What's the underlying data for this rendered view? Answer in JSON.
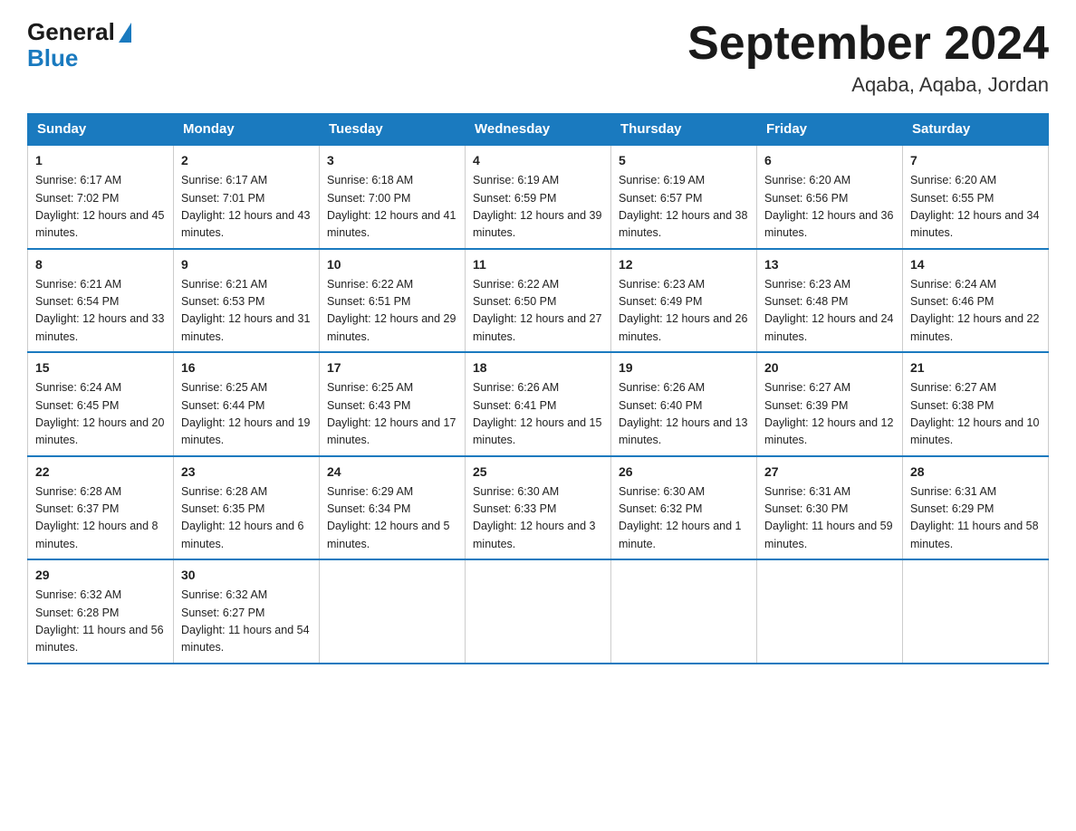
{
  "logo": {
    "general": "General",
    "blue": "Blue"
  },
  "title": "September 2024",
  "location": "Aqaba, Aqaba, Jordan",
  "days_of_week": [
    "Sunday",
    "Monday",
    "Tuesday",
    "Wednesday",
    "Thursday",
    "Friday",
    "Saturday"
  ],
  "weeks": [
    [
      {
        "day": "1",
        "sunrise": "6:17 AM",
        "sunset": "7:02 PM",
        "daylight": "12 hours and 45 minutes."
      },
      {
        "day": "2",
        "sunrise": "6:17 AM",
        "sunset": "7:01 PM",
        "daylight": "12 hours and 43 minutes."
      },
      {
        "day": "3",
        "sunrise": "6:18 AM",
        "sunset": "7:00 PM",
        "daylight": "12 hours and 41 minutes."
      },
      {
        "day": "4",
        "sunrise": "6:19 AM",
        "sunset": "6:59 PM",
        "daylight": "12 hours and 39 minutes."
      },
      {
        "day": "5",
        "sunrise": "6:19 AM",
        "sunset": "6:57 PM",
        "daylight": "12 hours and 38 minutes."
      },
      {
        "day": "6",
        "sunrise": "6:20 AM",
        "sunset": "6:56 PM",
        "daylight": "12 hours and 36 minutes."
      },
      {
        "day": "7",
        "sunrise": "6:20 AM",
        "sunset": "6:55 PM",
        "daylight": "12 hours and 34 minutes."
      }
    ],
    [
      {
        "day": "8",
        "sunrise": "6:21 AM",
        "sunset": "6:54 PM",
        "daylight": "12 hours and 33 minutes."
      },
      {
        "day": "9",
        "sunrise": "6:21 AM",
        "sunset": "6:53 PM",
        "daylight": "12 hours and 31 minutes."
      },
      {
        "day": "10",
        "sunrise": "6:22 AM",
        "sunset": "6:51 PM",
        "daylight": "12 hours and 29 minutes."
      },
      {
        "day": "11",
        "sunrise": "6:22 AM",
        "sunset": "6:50 PM",
        "daylight": "12 hours and 27 minutes."
      },
      {
        "day": "12",
        "sunrise": "6:23 AM",
        "sunset": "6:49 PM",
        "daylight": "12 hours and 26 minutes."
      },
      {
        "day": "13",
        "sunrise": "6:23 AM",
        "sunset": "6:48 PM",
        "daylight": "12 hours and 24 minutes."
      },
      {
        "day": "14",
        "sunrise": "6:24 AM",
        "sunset": "6:46 PM",
        "daylight": "12 hours and 22 minutes."
      }
    ],
    [
      {
        "day": "15",
        "sunrise": "6:24 AM",
        "sunset": "6:45 PM",
        "daylight": "12 hours and 20 minutes."
      },
      {
        "day": "16",
        "sunrise": "6:25 AM",
        "sunset": "6:44 PM",
        "daylight": "12 hours and 19 minutes."
      },
      {
        "day": "17",
        "sunrise": "6:25 AM",
        "sunset": "6:43 PM",
        "daylight": "12 hours and 17 minutes."
      },
      {
        "day": "18",
        "sunrise": "6:26 AM",
        "sunset": "6:41 PM",
        "daylight": "12 hours and 15 minutes."
      },
      {
        "day": "19",
        "sunrise": "6:26 AM",
        "sunset": "6:40 PM",
        "daylight": "12 hours and 13 minutes."
      },
      {
        "day": "20",
        "sunrise": "6:27 AM",
        "sunset": "6:39 PM",
        "daylight": "12 hours and 12 minutes."
      },
      {
        "day": "21",
        "sunrise": "6:27 AM",
        "sunset": "6:38 PM",
        "daylight": "12 hours and 10 minutes."
      }
    ],
    [
      {
        "day": "22",
        "sunrise": "6:28 AM",
        "sunset": "6:37 PM",
        "daylight": "12 hours and 8 minutes."
      },
      {
        "day": "23",
        "sunrise": "6:28 AM",
        "sunset": "6:35 PM",
        "daylight": "12 hours and 6 minutes."
      },
      {
        "day": "24",
        "sunrise": "6:29 AM",
        "sunset": "6:34 PM",
        "daylight": "12 hours and 5 minutes."
      },
      {
        "day": "25",
        "sunrise": "6:30 AM",
        "sunset": "6:33 PM",
        "daylight": "12 hours and 3 minutes."
      },
      {
        "day": "26",
        "sunrise": "6:30 AM",
        "sunset": "6:32 PM",
        "daylight": "12 hours and 1 minute."
      },
      {
        "day": "27",
        "sunrise": "6:31 AM",
        "sunset": "6:30 PM",
        "daylight": "11 hours and 59 minutes."
      },
      {
        "day": "28",
        "sunrise": "6:31 AM",
        "sunset": "6:29 PM",
        "daylight": "11 hours and 58 minutes."
      }
    ],
    [
      {
        "day": "29",
        "sunrise": "6:32 AM",
        "sunset": "6:28 PM",
        "daylight": "11 hours and 56 minutes."
      },
      {
        "day": "30",
        "sunrise": "6:32 AM",
        "sunset": "6:27 PM",
        "daylight": "11 hours and 54 minutes."
      },
      null,
      null,
      null,
      null,
      null
    ]
  ]
}
